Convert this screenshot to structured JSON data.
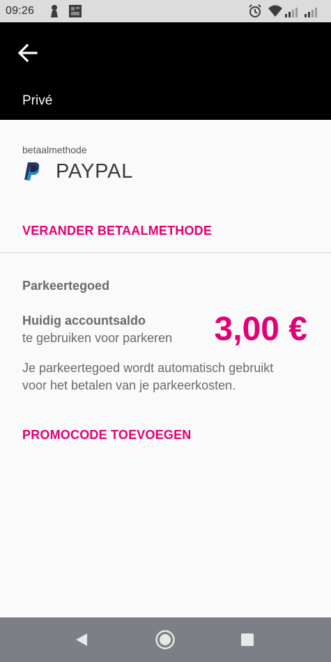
{
  "status_bar": {
    "time": "09:26",
    "icons": [
      "notification-icon",
      "image-icon",
      "alarm-icon",
      "wifi-icon",
      "signal-icon",
      "signal-icon"
    ]
  },
  "header": {
    "title": "Privé"
  },
  "payment_method": {
    "label": "betaalmethode",
    "name": "PAYPAL",
    "change_label": "VERANDER BETAALMETHODE"
  },
  "credit": {
    "title": "Parkeertegoed",
    "balance_label": "Huidig accountsaldo",
    "balance_sub": "te gebruiken voor parkeren",
    "amount": "3,00 €",
    "info": "Je parkeertegoed wordt automatisch gebruikt voor het betalen van je parkeerkosten.",
    "promo_label": "PROMOCODE TOEVOEGEN"
  },
  "colors": {
    "accent": "#e20074",
    "header_bg": "#000000",
    "status_bg": "#dcdcdc",
    "nav_bg": "#7d7f86"
  }
}
